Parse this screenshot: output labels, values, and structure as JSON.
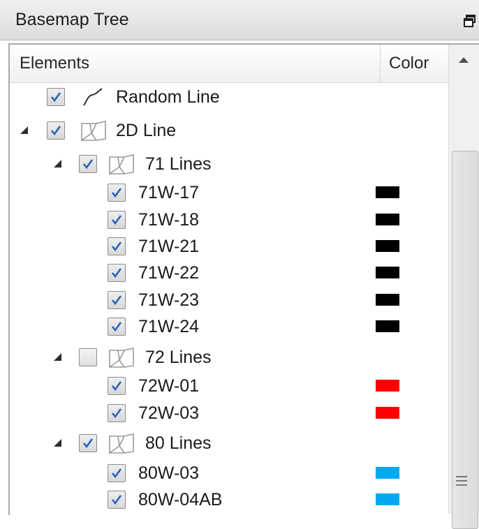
{
  "panel": {
    "title": "Basemap Tree",
    "columns": {
      "elements": "Elements",
      "color": "Color"
    }
  },
  "tree": {
    "random_line": {
      "label": "Random Line",
      "checked": true,
      "icon": "random-line-icon"
    },
    "group_2d": {
      "label": "2D Line",
      "checked": true,
      "expanded": true,
      "icon": "line-group-icon"
    },
    "group_71": {
      "label": "71 Lines",
      "checked": true,
      "expanded": true,
      "icon": "line-group-icon",
      "items": [
        {
          "label": "71W-17",
          "checked": true,
          "color": "#000000"
        },
        {
          "label": "71W-18",
          "checked": true,
          "color": "#000000"
        },
        {
          "label": "71W-21",
          "checked": true,
          "color": "#000000"
        },
        {
          "label": "71W-22",
          "checked": true,
          "color": "#000000"
        },
        {
          "label": "71W-23",
          "checked": true,
          "color": "#000000"
        },
        {
          "label": "71W-24",
          "checked": true,
          "color": "#000000"
        }
      ]
    },
    "group_72": {
      "label": "72 Lines",
      "checked": false,
      "expanded": true,
      "icon": "line-group-icon",
      "items": [
        {
          "label": "72W-01",
          "checked": true,
          "color": "#ff0000"
        },
        {
          "label": "72W-03",
          "checked": true,
          "color": "#ff0000"
        }
      ]
    },
    "group_80": {
      "label": "80 Lines",
      "checked": true,
      "expanded": true,
      "icon": "line-group-icon",
      "items": [
        {
          "label": "80W-03",
          "checked": true,
          "color": "#00aaf0"
        },
        {
          "label": "80W-04AB",
          "checked": true,
          "color": "#00aaf0"
        }
      ]
    }
  },
  "colors": {
    "checkmark": "#2a62b8",
    "expander": "#2d2d2d"
  }
}
